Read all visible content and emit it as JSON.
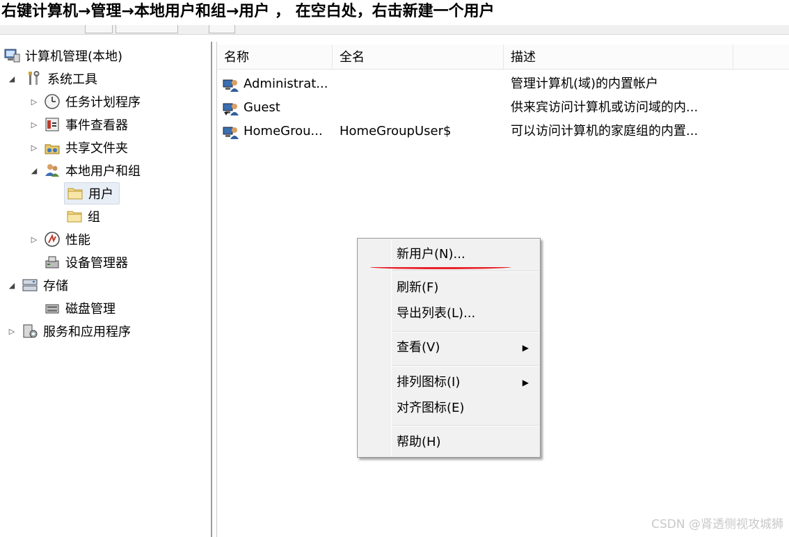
{
  "banner": {
    "text": "右键计算机→管理→本地用户和组→用户 ， 在空白处，右击新建一个用户"
  },
  "tree": {
    "items": [
      {
        "label": "计算机管理(本地)"
      },
      {
        "label": "系统工具"
      },
      {
        "label": "任务计划程序"
      },
      {
        "label": "事件查看器"
      },
      {
        "label": "共享文件夹"
      },
      {
        "label": "本地用户和组"
      },
      {
        "label": "用户"
      },
      {
        "label": "组"
      },
      {
        "label": "性能"
      },
      {
        "label": "设备管理器"
      },
      {
        "label": "存储"
      },
      {
        "label": "磁盘管理"
      },
      {
        "label": "服务和应用程序"
      }
    ]
  },
  "list": {
    "columns": [
      "名称",
      "全名",
      "描述"
    ],
    "rows": [
      {
        "name": "Administrat...",
        "fullname": "",
        "desc": "管理计算机(域)的内置帐户"
      },
      {
        "name": "Guest",
        "fullname": "",
        "desc": "供来宾访问计算机或访问域的内..."
      },
      {
        "name": "HomeGrou...",
        "fullname": "HomeGroupUser$",
        "desc": "可以访问计算机的家庭组的内置..."
      }
    ]
  },
  "context_menu": {
    "items": [
      {
        "label": "新用户(N)..."
      },
      {
        "label": "刷新(F)"
      },
      {
        "label": "导出列表(L)..."
      },
      {
        "label": "查看(V)"
      },
      {
        "label": "排列图标(I)"
      },
      {
        "label": "对齐图标(E)"
      },
      {
        "label": "帮助(H)"
      }
    ],
    "highlight_color": "#e8222a"
  },
  "watermark": {
    "text": "CSDN @肾透侧视攻城狮"
  }
}
